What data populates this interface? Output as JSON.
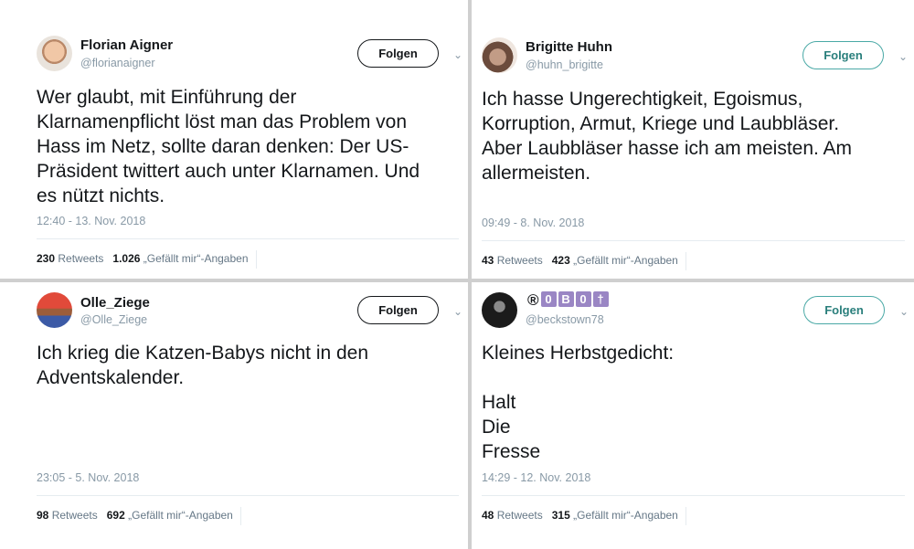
{
  "tweets": [
    {
      "name": "Florian Aigner",
      "handle": "@florianaigner",
      "follow_label": "Folgen",
      "text": "Wer glaubt, mit Einführung der\nKlarnamenpflicht löst man das Problem von\nHass im Netz, sollte daran denken: Der US-\nPräsident twittert auch unter Klarnamen. Und\nes nützt nichts.",
      "time": "12:40 - 13. Nov. 2018",
      "retweets_count": "230",
      "retweets_label": "Retweets",
      "likes_count": "1.026",
      "likes_label": "„Gefällt mir“-Angaben"
    },
    {
      "name": "Brigitte Huhn",
      "handle": "@huhn_brigitte",
      "follow_label": "Folgen",
      "text": "Ich hasse Ungerechtigkeit, Egoismus,\nKorruption, Armut, Kriege und Laubbläser.\nAber Laubbläser hasse ich am meisten. Am\nallermeisten.",
      "time": "09:49 - 8. Nov. 2018",
      "retweets_count": "43",
      "retweets_label": "Retweets",
      "likes_count": "423",
      "likes_label": "„Gefällt mir“-Angaben"
    },
    {
      "name": "Olle_Ziege",
      "handle": "@Olle_Ziege",
      "follow_label": "Folgen",
      "text": "Ich krieg die Katzen-Babys nicht  in den\nAdventskalender.",
      "time": "23:05 - 5. Nov. 2018",
      "retweets_count": "98",
      "retweets_label": "Retweets",
      "likes_count": "692",
      "likes_label": "„Gefällt mir“-Angaben"
    },
    {
      "name_badges": [
        "®",
        "0",
        "B",
        "0",
        "†"
      ],
      "handle": "@beckstown78",
      "follow_label": "Folgen",
      "text": "Kleines Herbstgedicht:\n\nHalt\nDie\nFresse",
      "time": "14:29 - 12. Nov. 2018",
      "retweets_count": "48",
      "retweets_label": "Retweets",
      "likes_count": "315",
      "likes_label": "„Gefällt mir“-Angaben"
    }
  ],
  "colors": {
    "follow_dark": "#14171a",
    "follow_teal": "#4aa9a6",
    "muted": "#8899a6",
    "badge_purple": "#9a86c4"
  },
  "icons": {
    "menu": "chevron-down-icon"
  }
}
